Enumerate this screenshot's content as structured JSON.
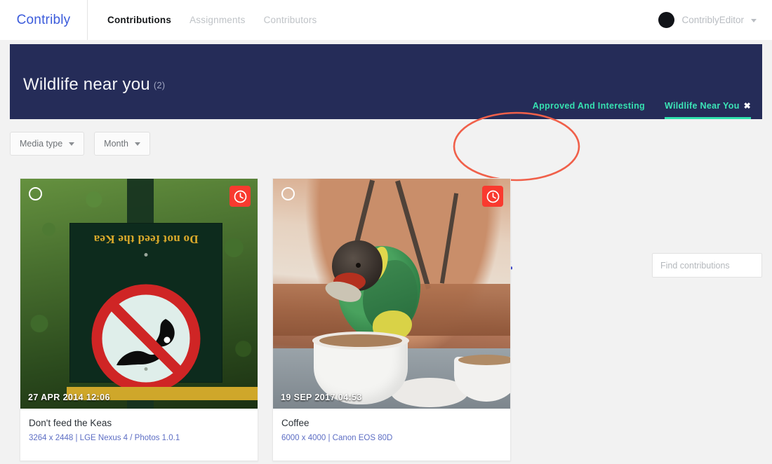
{
  "nav": {
    "brand": "Contribly",
    "links": [
      {
        "label": "Contributions",
        "active": true
      },
      {
        "label": "Assignments",
        "active": false
      },
      {
        "label": "Contributors",
        "active": false
      }
    ],
    "user": {
      "name": "ContriblyEditor",
      "avatar_icon": "avatar-circle-icon",
      "caret_icon": "chevron-down-icon"
    }
  },
  "banner": {
    "title": "Wildlife near you",
    "count": "(2)",
    "color": "#252c58",
    "tabs": [
      {
        "label": "Approved And Interesting",
        "active": false,
        "closable": false
      },
      {
        "label": "Wildlife Near You",
        "active": true,
        "closable": true,
        "close_icon": "close-x-icon"
      }
    ],
    "accent": "#2fe3ae"
  },
  "toolbar": {
    "filters": [
      {
        "label": "Media type",
        "caret_icon": "chevron-down-icon"
      },
      {
        "label": "Month",
        "caret_icon": "chevron-down-icon"
      }
    ],
    "view_icons": [
      {
        "name": "list-view-icon",
        "color": "#3d5afe"
      },
      {
        "name": "grid-view-icon",
        "color": "#3d5afe"
      },
      {
        "name": "collapse-all-circle-icon",
        "color": "#8c9096"
      },
      {
        "name": "clear-selection-circle-icon",
        "color": "#8c9096"
      }
    ],
    "download": {
      "name": "download-icon",
      "color": "#3d47c8"
    },
    "search": {
      "placeholder": "Find contributions",
      "value": ""
    }
  },
  "annotation": {
    "shape": "ellipse",
    "color": "#f0604a",
    "target": "download-icon"
  },
  "cards": [
    {
      "timestamp": "27 APR 2014 12:06",
      "title": "Don't feed the Keas",
      "meta": "3264 x 2448 | LGE Nexus 4 / Photos 1.0.1",
      "photo": "do-not-feed-the-kea-sign",
      "sign_text": "Do not feed the Kea",
      "selected": false,
      "status_badge": {
        "icon": "clock-icon",
        "color": "#f93a2f"
      }
    },
    {
      "timestamp": "19 SEP 2017 04:53",
      "title": "Coffee",
      "meta": "6000 x 4000 | Canon EOS 80D",
      "photo": "parrot-on-coffee-cup",
      "selected": false,
      "status_badge": {
        "icon": "clock-icon",
        "color": "#f93a2f"
      }
    }
  ]
}
